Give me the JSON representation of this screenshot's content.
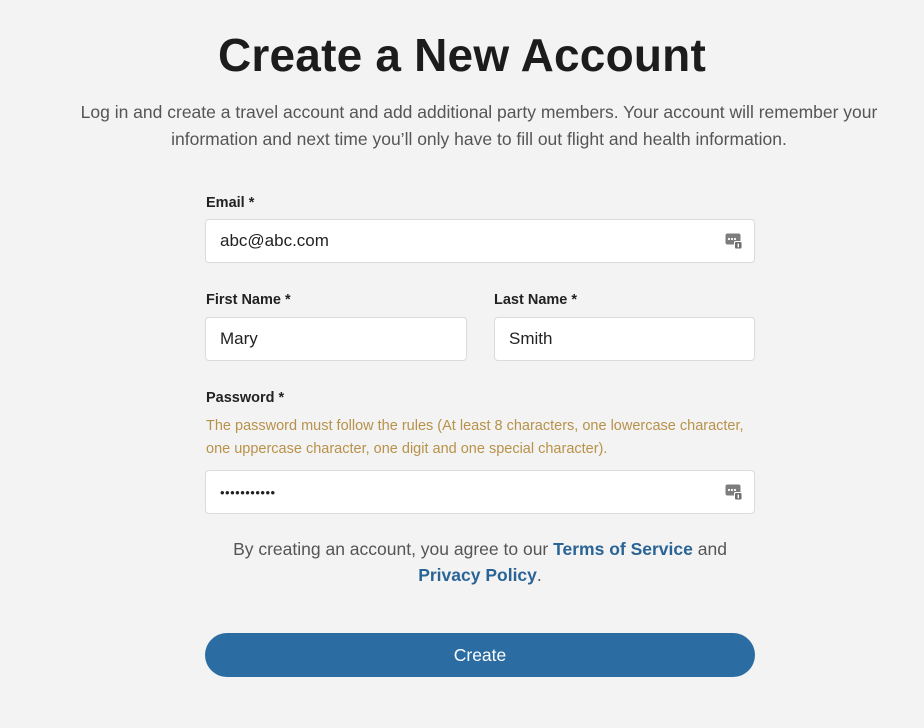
{
  "header": {
    "title": "Create a New Account",
    "intro": "Log in and create a travel account and add additional party members. Your account will remember your information and next time you’ll only have to fill out flight and health information."
  },
  "form": {
    "email": {
      "label": "Email *",
      "value": "abc@abc.com",
      "icon": "password-manager-key-icon"
    },
    "first_name": {
      "label": "First Name *",
      "value": "Mary"
    },
    "last_name": {
      "label": "Last Name *",
      "value": "Smith"
    },
    "password": {
      "label": "Password *",
      "hint": "The password must follow the rules (At least 8 characters, one lowercase character, one uppercase character, one digit and one special character).",
      "value": "Password1!x",
      "icon": "password-manager-key-icon"
    },
    "agreement": {
      "prefix": "By creating an account, you agree to our ",
      "terms_link": "Terms of Service",
      "middle": " and",
      "privacy_link": "Privacy Policy",
      "suffix": "."
    },
    "submit_label": "Create"
  },
  "colors": {
    "background": "#f2f3f2",
    "accent": "#2b6ca3",
    "link": "#2a6496",
    "hint": "#b8924a"
  }
}
